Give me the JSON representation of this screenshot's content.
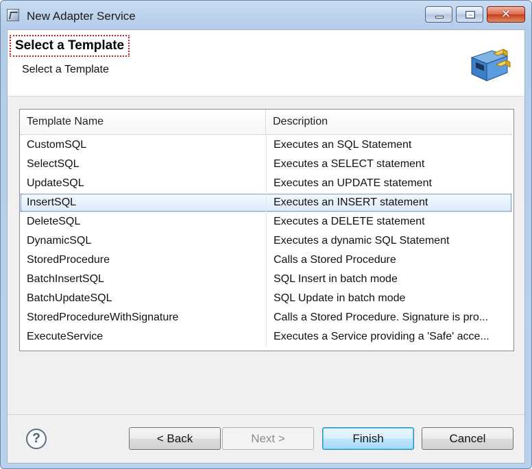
{
  "window": {
    "title": "New Adapter Service",
    "close_glyph": "✕"
  },
  "banner": {
    "title": "Select a Template",
    "subtitle": "Select a Template",
    "graphic_icon": "adapter-plug-icon"
  },
  "table": {
    "columns": [
      "Template Name",
      "Description"
    ],
    "rows": [
      {
        "name": "CustomSQL",
        "description": "Executes an SQL Statement"
      },
      {
        "name": "SelectSQL",
        "description": "Executes a SELECT statement"
      },
      {
        "name": "UpdateSQL",
        "description": "Executes an UPDATE statement"
      },
      {
        "name": "InsertSQL",
        "description": "Executes an INSERT statement",
        "selected": true
      },
      {
        "name": "DeleteSQL",
        "description": "Executes a DELETE statement"
      },
      {
        "name": "DynamicSQL",
        "description": "Executes a dynamic SQL Statement"
      },
      {
        "name": "StoredProcedure",
        "description": "Calls a Stored Procedure"
      },
      {
        "name": "BatchInsertSQL",
        "description": "SQL Insert in batch mode"
      },
      {
        "name": "BatchUpdateSQL",
        "description": "SQL Update in batch mode"
      },
      {
        "name": "StoredProcedureWithSignature",
        "description": "Calls a Stored Procedure. Signature is pro..."
      },
      {
        "name": "ExecuteService",
        "description": "Executes a Service providing a 'Safe' acce..."
      }
    ]
  },
  "footer": {
    "help_glyph": "?",
    "back_label": "< Back",
    "next_label": "Next >",
    "finish_label": "Finish",
    "cancel_label": "Cancel"
  },
  "colors": {
    "selection": "#dbeaf9",
    "title_highlight": "#d0181f",
    "default_button": "#bee6fd"
  }
}
